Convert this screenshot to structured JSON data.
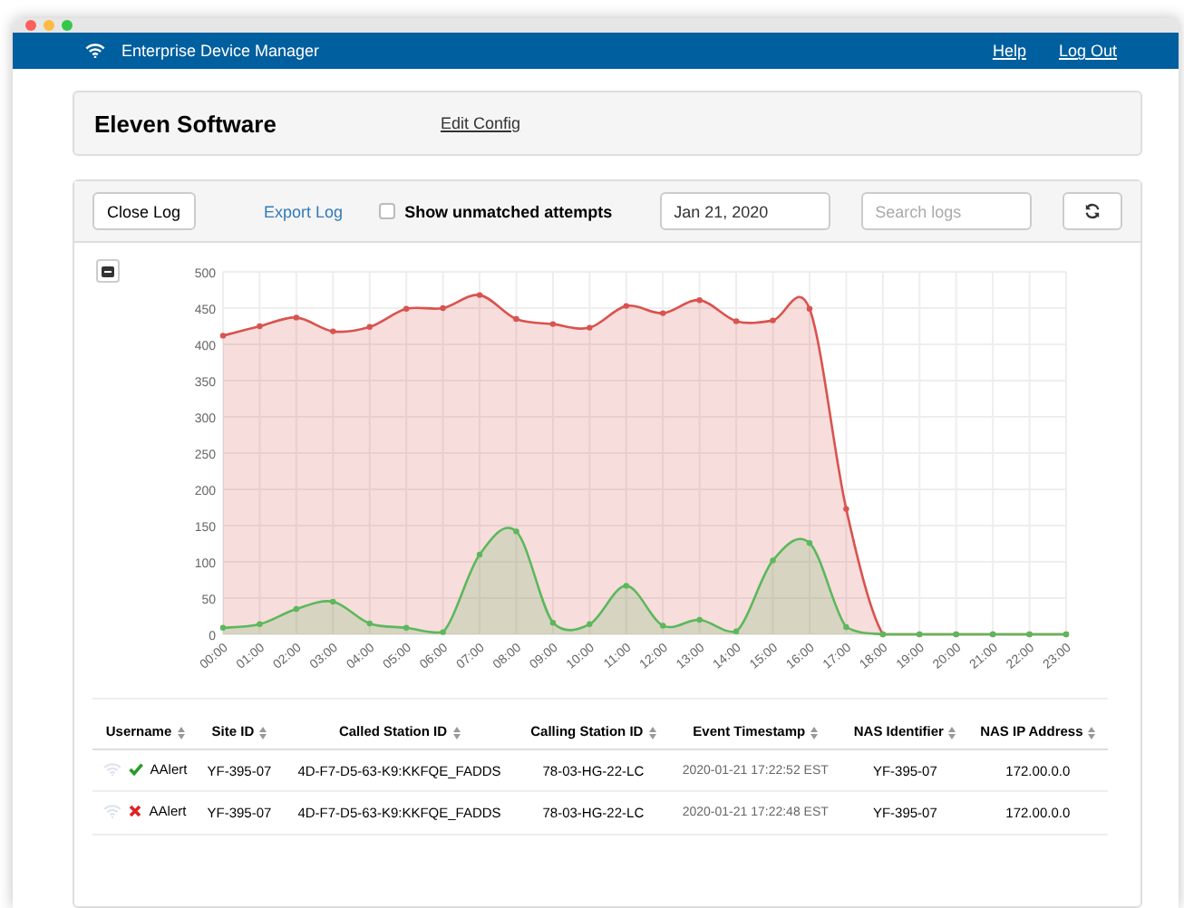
{
  "header": {
    "title": "Enterprise Device Manager",
    "links": [
      "Help",
      "Log Out"
    ]
  },
  "org": {
    "name": "Eleven Software",
    "link": "Edit Config"
  },
  "toolbar": {
    "close": "Close Log",
    "export": "Export Log",
    "unmatched": {
      "label": "Show unmatched attempts",
      "checked": false
    },
    "date": "Jan 21, 2020",
    "search": {
      "placeholder": "Search logs"
    }
  },
  "chart_data": {
    "type": "area",
    "grid": true,
    "categories": [
      "00:00",
      "01:00",
      "02:00",
      "03:00",
      "04:00",
      "05:00",
      "06:00",
      "07:00",
      "08:00",
      "09:00",
      "10:00",
      "11:00",
      "12:00",
      "13:00",
      "14:00",
      "15:00",
      "16:00",
      "17:00",
      "18:00",
      "19:00",
      "20:00",
      "21:00",
      "22:00",
      "23:00"
    ],
    "ylim": [
      0,
      500
    ],
    "yticks": [
      0,
      50,
      100,
      150,
      200,
      250,
      300,
      350,
      400,
      450,
      500
    ],
    "series": [
      {
        "color": "#d9534f",
        "values": [
          412,
          425,
          437,
          418,
          424,
          449,
          450,
          468,
          435,
          428,
          423,
          453,
          443,
          461,
          432,
          433,
          449,
          173,
          0,
          0,
          0,
          0,
          0,
          0
        ]
      },
      {
        "color": "#5cb85c",
        "values": [
          9,
          14,
          35,
          45,
          15,
          9,
          3,
          110,
          142,
          16,
          14,
          67,
          12,
          20,
          4,
          102,
          126,
          10,
          0,
          0,
          0,
          0,
          0,
          0
        ]
      }
    ]
  },
  "table": {
    "columns": [
      "Username",
      "Site ID",
      "Called Station ID",
      "Calling Station ID",
      "Event Timestamp",
      "NAS Identifier",
      "NAS IP Address"
    ],
    "rows": [
      {
        "success": true,
        "cells": [
          "AAlert",
          "YF-395-07",
          "4D-F7-D5-63-K9:KKFQE_FADDS",
          "78-03-HG-22-LC",
          "2020-01-21 17:22:52 EST",
          "YF-395-07",
          "172.00.0.0"
        ]
      },
      {
        "success": false,
        "cells": [
          "AAlert",
          "YF-395-07",
          "4D-F7-D5-63-K9:KKFQE_FADDS",
          "78-03-HG-22-LC",
          "2020-01-21 17:22:48 EST",
          "YF-395-07",
          "172.00.0.0"
        ]
      }
    ]
  }
}
